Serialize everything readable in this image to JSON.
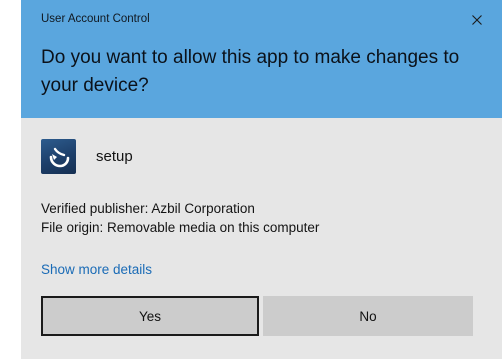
{
  "window": {
    "title": "User Account Control",
    "close_icon": "close-icon"
  },
  "prompt": {
    "question": "Do you want to allow this app to make changes to your device?"
  },
  "app": {
    "icon": "setup-app-icon",
    "name": "setup"
  },
  "info": {
    "publisher": "Verified publisher: Azbil Corporation",
    "origin": "File origin: Removable media on this computer"
  },
  "links": {
    "show_more": "Show more details"
  },
  "buttons": {
    "yes": "Yes",
    "no": "No"
  },
  "colors": {
    "header": "#5aa6de",
    "panel": "#e6e6e6",
    "link": "#1a6bb6",
    "button": "#cccccc"
  }
}
